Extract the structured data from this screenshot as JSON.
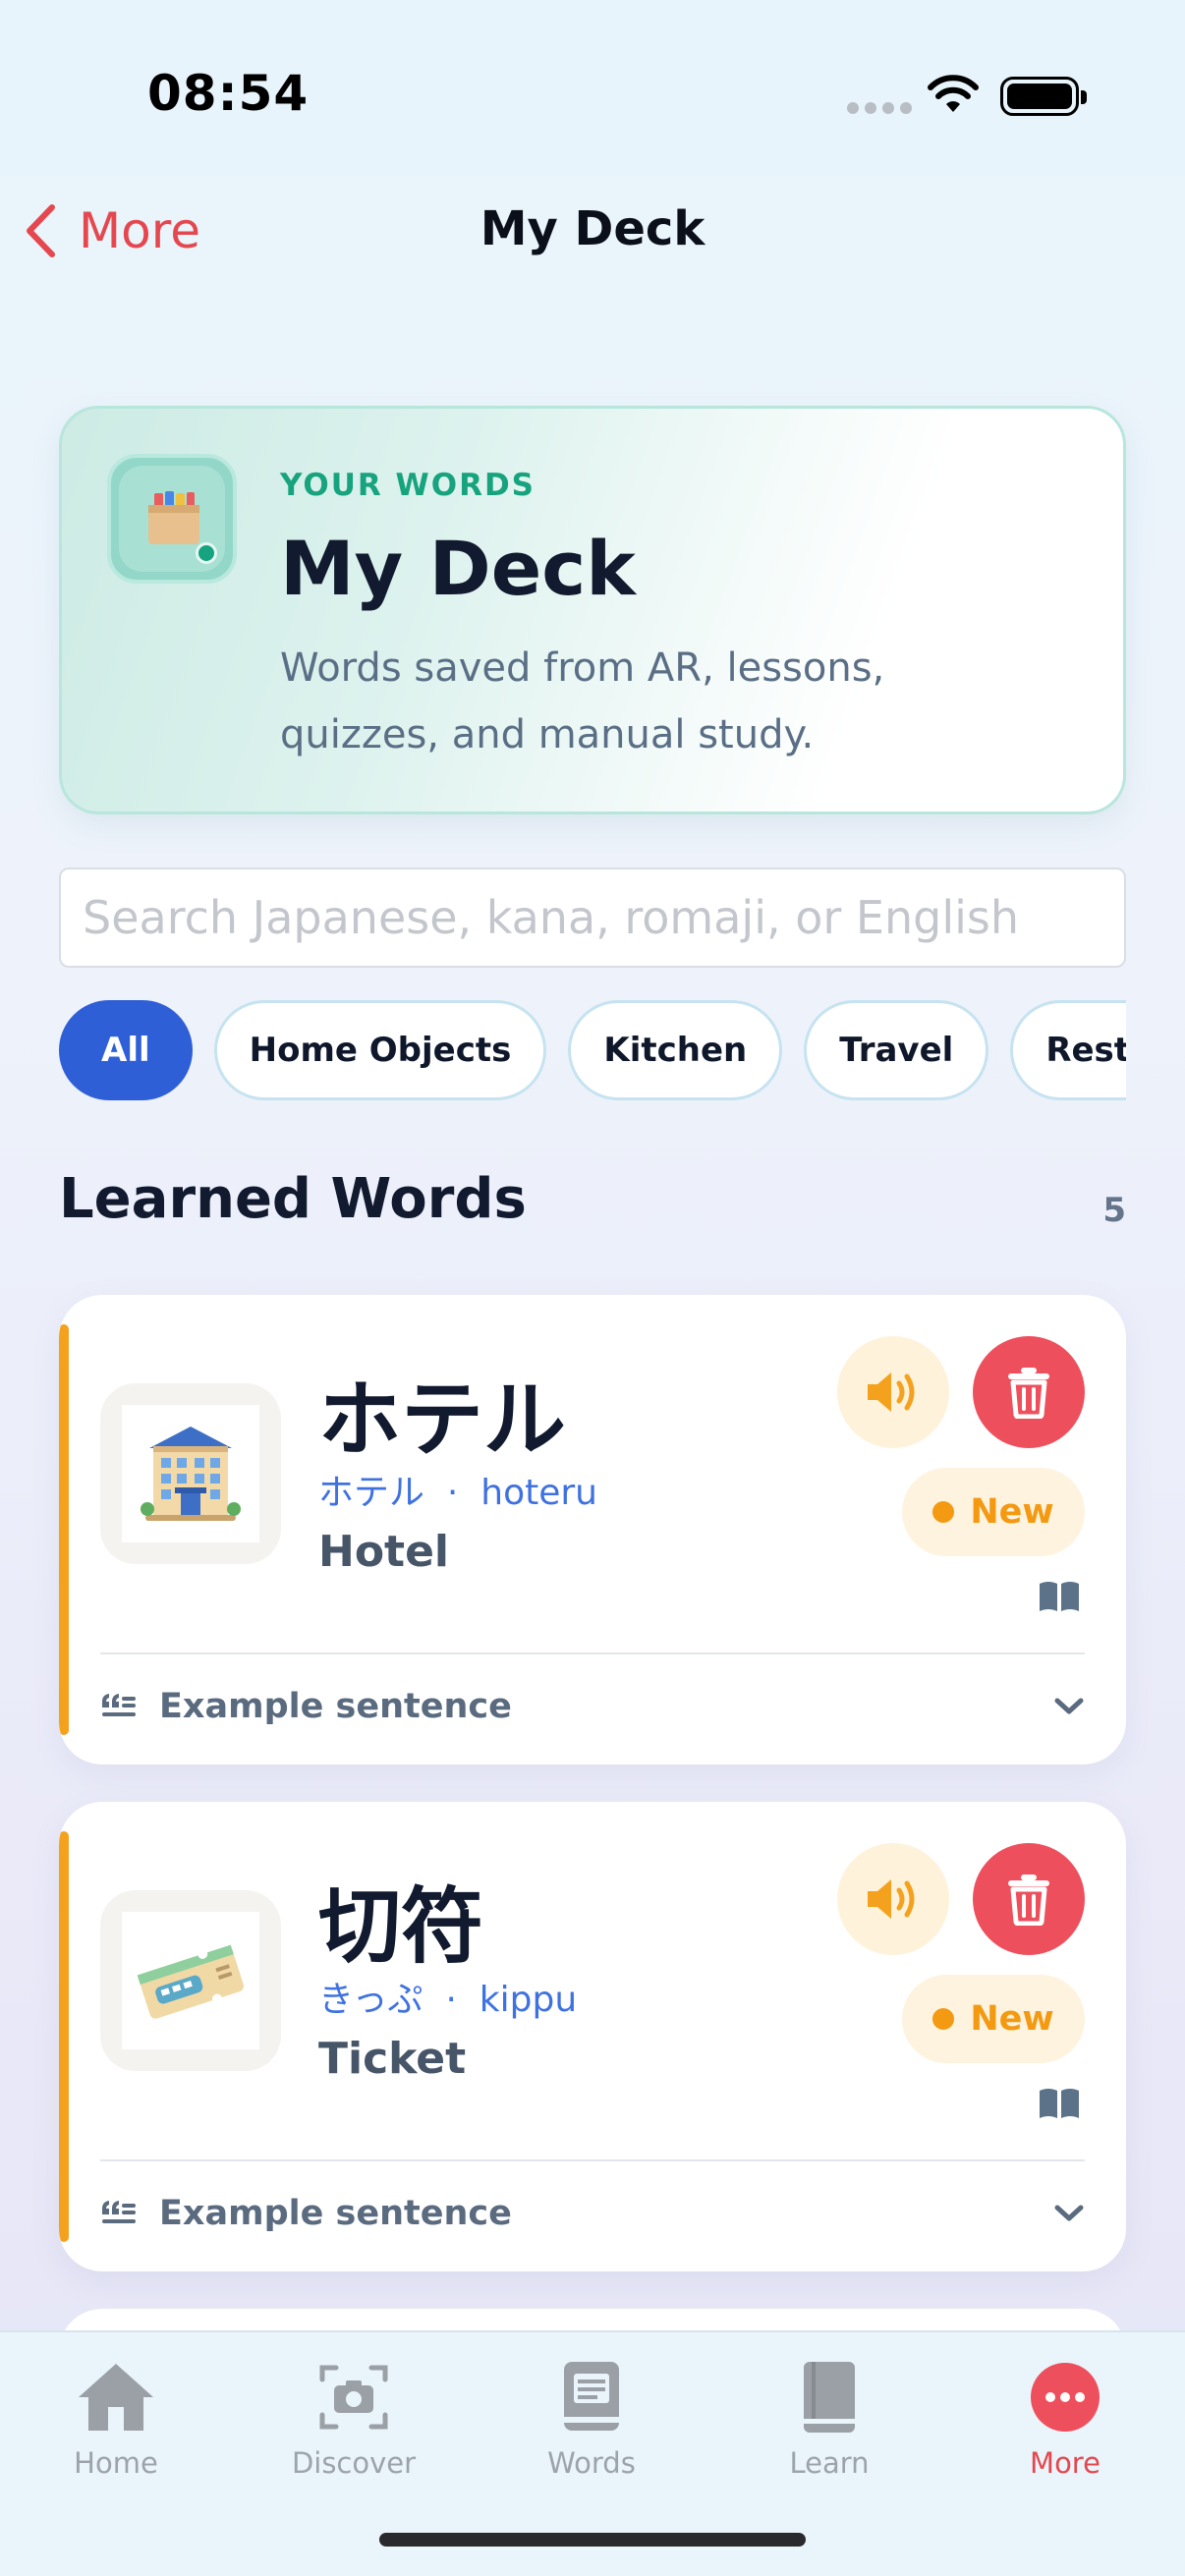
{
  "status_bar": {
    "time": "08:54"
  },
  "nav": {
    "back_label": "More",
    "title": "My Deck"
  },
  "hero": {
    "eyebrow": "YOUR WORDS",
    "title": "My Deck",
    "description": "Words saved from AR, lessons, quizzes, and manual study.",
    "icon": "card-box-icon"
  },
  "search": {
    "placeholder": "Search Japanese, kana, romaji, or English",
    "value": ""
  },
  "filters": {
    "selected": "All",
    "chips": [
      "All",
      "Home Objects",
      "Kitchen",
      "Travel",
      "Resta"
    ]
  },
  "section": {
    "title": "Learned Words",
    "count": "5"
  },
  "words": [
    {
      "japanese": "ホテル",
      "kana": "ホテル",
      "separator": "·",
      "romaji": "hoteru",
      "english": "Hotel",
      "status": "New",
      "example_label": "Example sentence",
      "image_icon": "hotel-building-icon"
    },
    {
      "japanese": "切符",
      "kana": "きっぷ",
      "separator": "·",
      "romaji": "kippu",
      "english": "Ticket",
      "status": "New",
      "example_label": "Example sentence",
      "image_icon": "train-ticket-icon"
    }
  ],
  "tab_bar": {
    "active": "More",
    "tabs": [
      {
        "label": "Home",
        "icon": "house-icon"
      },
      {
        "label": "Discover",
        "icon": "camera-icon"
      },
      {
        "label": "Words",
        "icon": "book-list-icon"
      },
      {
        "label": "Learn",
        "icon": "book-icon"
      },
      {
        "label": "More",
        "icon": "more-dots-icon"
      }
    ]
  },
  "colors": {
    "accent_red": "#e5474f",
    "accent_blue": "#2f5fd6",
    "accent_teal": "#17a37e",
    "accent_orange": "#f39a12",
    "reading_blue": "#3f72e0"
  }
}
